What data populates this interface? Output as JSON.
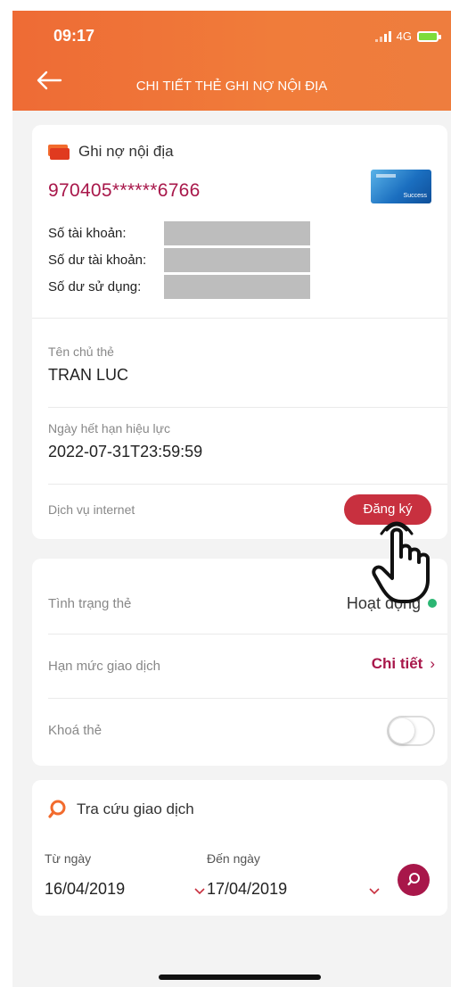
{
  "status_bar": {
    "time": "09:17",
    "network": "4G"
  },
  "header": {
    "title": "CHI TIẾT THẺ GHI NỢ NỘI ĐỊA"
  },
  "card_summary": {
    "type_label": "Ghi nợ nội địa",
    "number": "970405******6766",
    "thumbnail_text": "Success",
    "accounts": [
      {
        "label": "Số tài khoản:"
      },
      {
        "label": "Số dư tài khoản:"
      },
      {
        "label": "Số dư sử dụng:"
      }
    ]
  },
  "holder": {
    "label": "Tên chủ thẻ",
    "value": "TRAN LUC"
  },
  "expiry": {
    "label": "Ngày hết hạn hiệu lực",
    "value": "2022-07-31T23:59:59"
  },
  "internet_service": {
    "label": "Dịch vụ internet",
    "button": "Đăng ký"
  },
  "card_status": {
    "label": "Tình trạng thẻ",
    "value": "Hoạt động",
    "dot_color": "#2bb673"
  },
  "limit": {
    "label": "Hạn mức giao dịch",
    "link": "Chi tiết",
    "chevron": "›"
  },
  "lock": {
    "label": "Khoá thẻ",
    "enabled": false
  },
  "transaction_search": {
    "title": "Tra cứu giao dịch",
    "from_label": "Từ ngày",
    "from_value": "16/04/2019",
    "to_label": "Đến ngày",
    "to_value": "17/04/2019"
  },
  "colors": {
    "header": "#ee6b35",
    "accent": "#a8174a",
    "button": "#c8303f"
  }
}
